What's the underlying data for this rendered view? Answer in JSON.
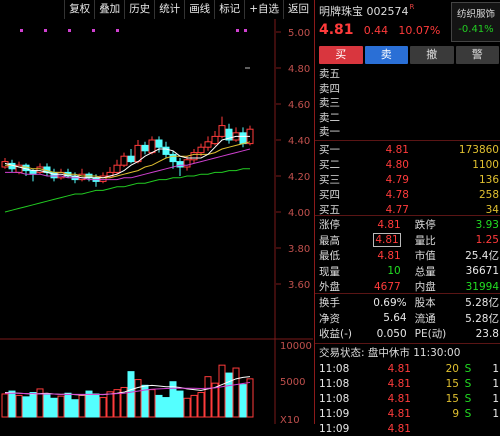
{
  "toolbar": [
    {
      "name": "restore-rights-button",
      "label": "复权"
    },
    {
      "name": "overlay-button",
      "label": "叠加"
    },
    {
      "name": "history-button",
      "label": "历史"
    },
    {
      "name": "stats-button",
      "label": "统计"
    },
    {
      "name": "draw-line-button",
      "label": "画线"
    },
    {
      "name": "mark-button",
      "label": "标记"
    },
    {
      "name": "add-watchlist-button",
      "label": "+自选"
    },
    {
      "name": "back-button",
      "label": "返回"
    }
  ],
  "chart": {
    "y_ticks": [
      "5.00",
      "4.80",
      "4.60",
      "4.40",
      "4.20",
      "4.00",
      "3.80",
      "3.60"
    ],
    "volume_ticks": [
      "10000",
      "5000"
    ],
    "volume_unit": "X10",
    "colors": {
      "up": "#ff3b3b",
      "down": "#54ffff",
      "ma5": "#ffffff",
      "ma10": "#e0c030",
      "ma20": "#d040d0",
      "ma60": "#22cc22",
      "dot": "#d040d0"
    }
  },
  "stock": {
    "name": "明牌珠宝",
    "code": "002574",
    "badge": "R",
    "price": "4.81",
    "change": "0.44",
    "change_pct": "10.07%",
    "sector_name": "纺织服饰",
    "sector_change": "-0.41%"
  },
  "actions": {
    "buy": "买",
    "sell": "卖",
    "cancel": "撤",
    "all": "警"
  },
  "sell_orders": [
    "卖五",
    "卖四",
    "卖三",
    "卖二",
    "卖一"
  ],
  "buy_orders": [
    {
      "label": "买一",
      "price": "4.81",
      "volume": "173860"
    },
    {
      "label": "买二",
      "price": "4.80",
      "volume": "1100"
    },
    {
      "label": "买三",
      "price": "4.79",
      "volume": "136"
    },
    {
      "label": "买四",
      "price": "4.78",
      "volume": "258"
    },
    {
      "label": "买五",
      "price": "4.77",
      "volume": "34"
    }
  ],
  "quote": {
    "limit_up_label": "涨停",
    "limit_up": "4.81",
    "limit_down_label": "跌停",
    "limit_down": "3.93",
    "high_label": "最高",
    "high": "4.81",
    "vol_ratio_label": "量比",
    "vol_ratio": "1.25",
    "low_label": "最低",
    "low": "4.81",
    "mkt_cap_label": "市值",
    "mkt_cap": "25.4亿",
    "cur_vol_label": "现量",
    "cur_vol": "10",
    "total_vol_label": "总量",
    "total_vol": "36671",
    "outer_label": "外盘",
    "outer": "4677",
    "inner_label": "内盘",
    "inner": "31994"
  },
  "stats": {
    "turnover_label": "换手",
    "turnover": "0.69%",
    "share_cap_label": "股本",
    "share_cap": "5.28亿",
    "nav_label": "净资",
    "nav": "5.64",
    "float_label": "流通",
    "float": "5.28亿",
    "eps_label": "收益(-)",
    "eps": "0.050",
    "pe_label": "PE(动)",
    "pe": "23.8"
  },
  "trade_status": {
    "label": "交易状态:",
    "value": "盘中休市 11:30:00"
  },
  "ticks": [
    {
      "time": "11:08",
      "price": "4.81",
      "vol": "20",
      "dir": "S",
      "count": "1"
    },
    {
      "time": "11:08",
      "price": "4.81",
      "vol": "15",
      "dir": "S",
      "count": "1"
    },
    {
      "time": "11:08",
      "price": "4.81",
      "vol": "15",
      "dir": "S",
      "count": "1"
    },
    {
      "time": "11:09",
      "price": "4.81",
      "vol": "9",
      "dir": "S",
      "count": "1"
    },
    {
      "time": "11:09",
      "price": "4.81",
      "vol": "",
      "dir": "",
      "count": ""
    }
  ]
}
